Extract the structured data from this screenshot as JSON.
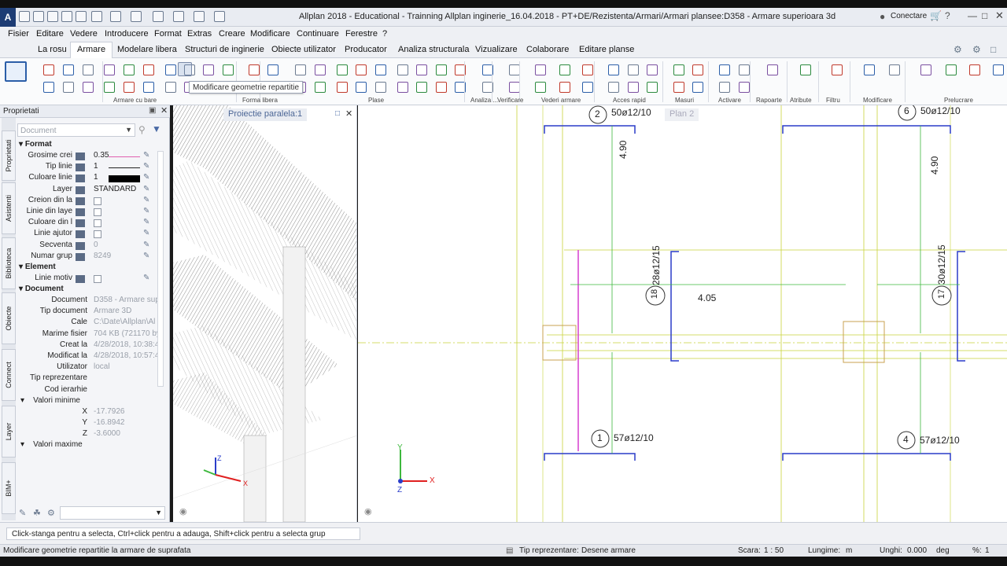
{
  "window": {
    "title": "Allplan 2018 - Educational - Trainning Allplan inginerie_16.04.2018 - PT+DE/Rezistenta/Armari/Armari plansee:D358 - Armare superioara 3d",
    "connect_label": "Conectare",
    "help_glyph": "?"
  },
  "menu": [
    "Fisier",
    "Editare",
    "Vedere",
    "Introducere",
    "Format",
    "Extras",
    "Creare",
    "Modificare",
    "Continuare",
    "Ferestre",
    "?"
  ],
  "tabs": [
    "La rosu",
    "Armare",
    "Modelare libera",
    "Structuri de inginerie",
    "Obiecte utilizator",
    "Producator",
    "Analiza structurala",
    "Vizualizare",
    "Colaborare",
    "Editare planse"
  ],
  "active_tab": "Armare",
  "ribbon_groups": [
    "Armare cu bare",
    "Forma libera",
    "Plase",
    "Analiza ...",
    "Verificare",
    "Vederi armare",
    "Acces rapid",
    "Masuri",
    "Activare",
    "Rapoarte",
    "Atribute",
    "Filtru",
    "Modificare",
    "Prelucrare"
  ],
  "tooltip": "Modificare geometrie repartitie",
  "properties": {
    "title": "Proprietati",
    "dropdown_value": "Document",
    "side_tabs": [
      "Proprietati",
      "Asistenti",
      "Biblioteca",
      "Obiecte",
      "Connect",
      "Layer",
      "BIM+"
    ],
    "sections": {
      "format": "Format",
      "element": "Element",
      "document": "Document"
    },
    "format_rows": [
      {
        "label": "Grosime crei",
        "value": "0.35"
      },
      {
        "label": "Tip linie",
        "value": "1"
      },
      {
        "label": "Culoare linie",
        "value": "1"
      },
      {
        "label": "Layer",
        "value": "STANDARD"
      },
      {
        "label": "Creion din la",
        "value": ""
      },
      {
        "label": "Linie din laye",
        "value": ""
      },
      {
        "label": "Culoare din l",
        "value": ""
      },
      {
        "label": "Linie ajutor",
        "value": ""
      },
      {
        "label": "Secventa",
        "value": "0"
      },
      {
        "label": "Numar grup",
        "value": "8249"
      }
    ],
    "element_rows": [
      {
        "label": "Linie motiv",
        "value": ""
      }
    ],
    "document_rows": [
      {
        "label": "Document",
        "value": "D358 - Armare sup"
      },
      {
        "label": "Tip document",
        "value": "Armare 3D"
      },
      {
        "label": "Cale",
        "value": "C:\\Date\\Allplan\\Al"
      },
      {
        "label": "Marime fisier",
        "value": "704 KB (721170 by"
      },
      {
        "label": "Creat la",
        "value": "4/28/2018, 10:38:4"
      },
      {
        "label": "Modificat la",
        "value": "4/28/2018, 10:57:4"
      },
      {
        "label": "Utilizator",
        "value": "local"
      },
      {
        "label": "Tip reprezentare",
        "value": ""
      },
      {
        "label": "Cod ierarhie",
        "value": ""
      }
    ],
    "valori_minime": "Valori minime",
    "min_values": [
      {
        "label": "X",
        "value": "-17.7926"
      },
      {
        "label": "Y",
        "value": "-16.8942"
      },
      {
        "label": "Z",
        "value": "-3.6000"
      }
    ],
    "valori_maxime": "Valori maxime"
  },
  "views": {
    "view3d_title": "Proiectie paralela:1",
    "plan_title": "Plan 2"
  },
  "plan": {
    "label_2": "2",
    "text_2": "50ø12/10",
    "label_6": "6",
    "text_6": "50ø12/10",
    "dim_left": "4.90",
    "dim_right": "4.90",
    "label_18": "18",
    "text_18": "28ø12/15",
    "dim_mid": "4.05",
    "label_17": "17",
    "text_17": "30ø12/15",
    "label_1": "1",
    "text_1": "57ø12/10",
    "label_4": "4",
    "text_4": "57ø12/10",
    "axis_x": "X",
    "axis_y": "Y",
    "axis_z": "Z"
  },
  "status": {
    "hint": "Click-stanga pentru a selecta, Ctrl+click pentru a adauga, Shift+click pentru a selecta grup",
    "action": "Modificare geometrie repartitie la armare de suprafata",
    "tip_reprezentare_lbl": "Tip reprezentare:",
    "tip_reprezentare_val": "Desene armare",
    "scara_lbl": "Scara:",
    "scara_val": "1 : 50",
    "lungime_lbl": "Lungime:",
    "lungime_val": "m",
    "unghi_lbl": "Unghi:",
    "unghi_val": "0.000",
    "unghi_unit": "deg",
    "pct_lbl": "%:",
    "pct_val": "1"
  },
  "colors": {
    "accent": "#1d3c74",
    "rebar_blue": "#2a3cc9",
    "rebar_magenta": "#d63fcf",
    "grid_yellow": "#c8d23a",
    "axis_green": "#3db83d",
    "axis_red": "#e02020"
  }
}
